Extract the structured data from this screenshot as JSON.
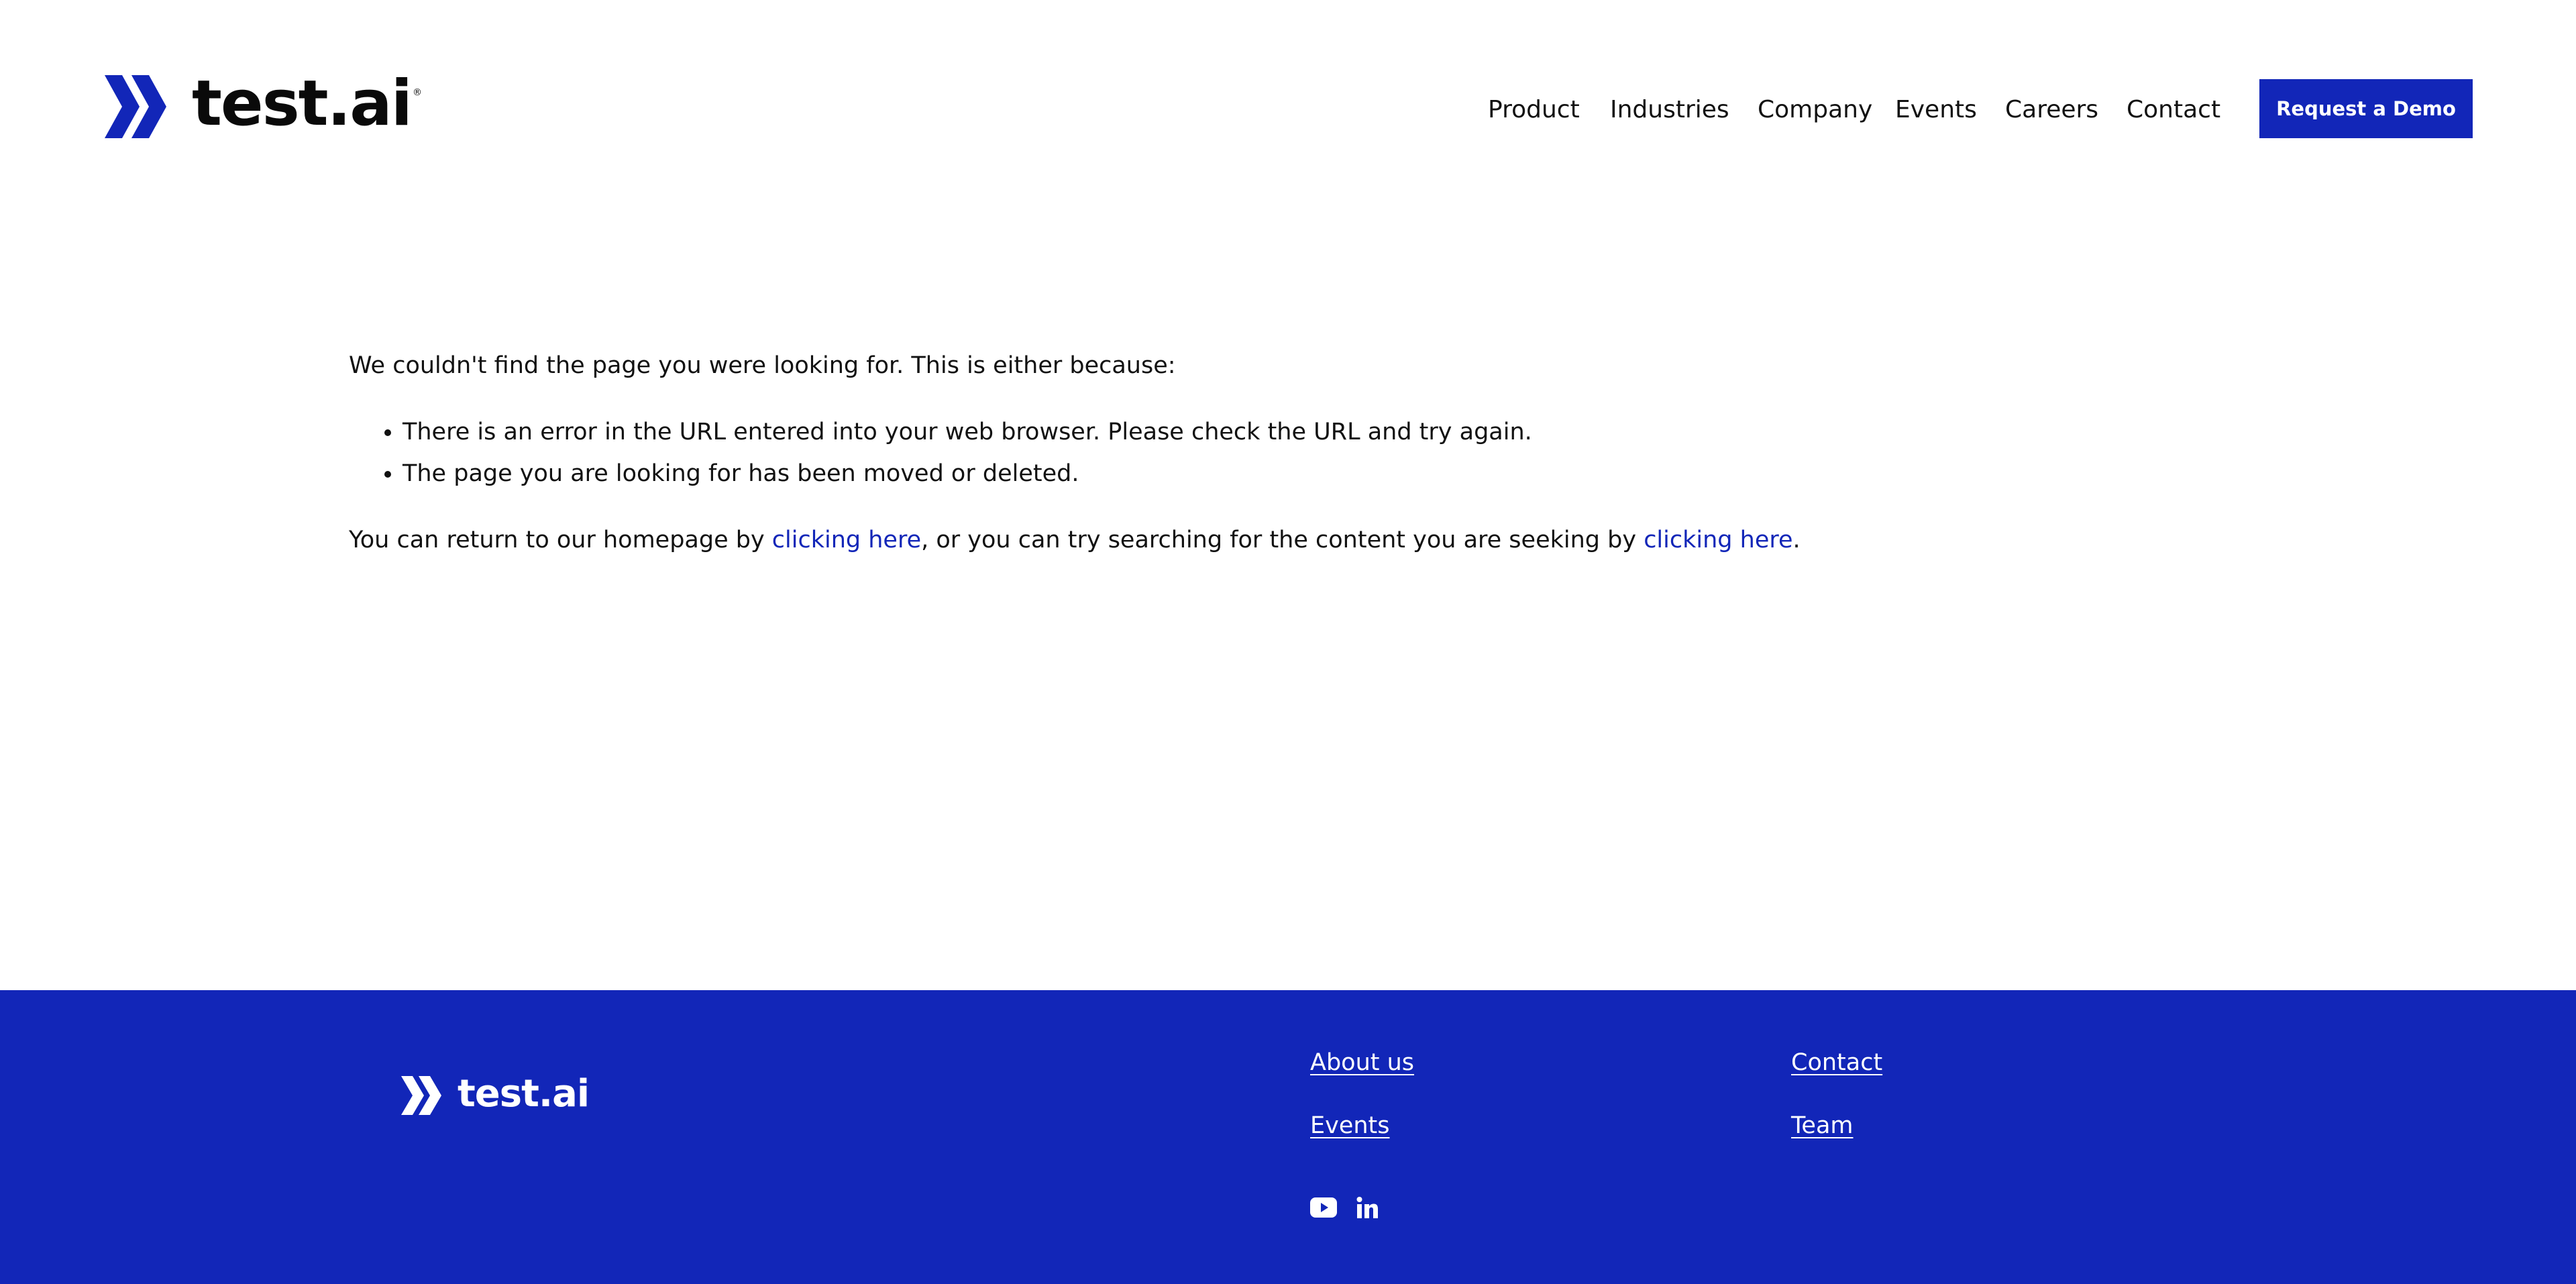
{
  "brand": {
    "name": "test.ai",
    "trademark": "®",
    "colors": {
      "primary": "#1226b8",
      "text": "#111111",
      "background": "#ffffff"
    },
    "logo_icon": "double-chevron-logo-icon"
  },
  "header": {
    "nav": [
      {
        "label": "Product"
      },
      {
        "label": "Industries"
      },
      {
        "label": "Company"
      },
      {
        "label": "Events"
      },
      {
        "label": "Careers"
      },
      {
        "label": "Contact"
      }
    ],
    "cta_label": "Request a Demo"
  },
  "main": {
    "intro": "We couldn't find the page you were looking for. This is either because:",
    "reasons": [
      "There is an error in the URL entered into your web browser. Please check the URL and try again.",
      "The page you are looking for has been moved or deleted."
    ],
    "return_prefix": "You can return to our homepage by ",
    "home_link": "clicking here",
    "return_middle": ", or you can try searching for the content you are seeking by ",
    "search_link": "clicking here",
    "return_suffix": "."
  },
  "footer": {
    "logo_text": "test.ai",
    "links_col1": [
      "About us",
      "Events"
    ],
    "links_col2": [
      "Contact",
      "Team"
    ],
    "social": [
      {
        "icon": "youtube-icon"
      },
      {
        "icon": "linkedin-icon"
      }
    ]
  }
}
